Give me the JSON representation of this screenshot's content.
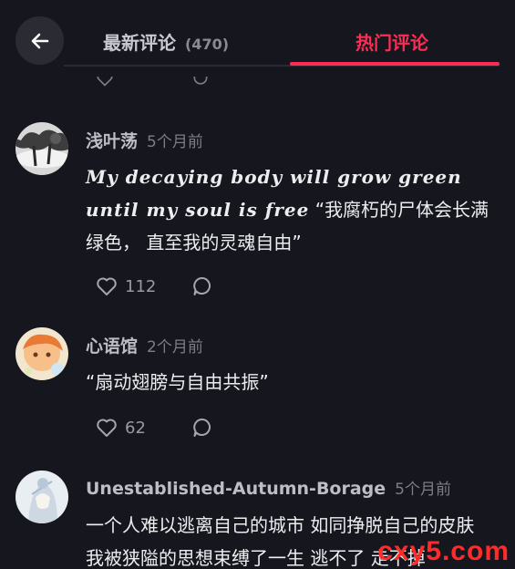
{
  "header": {
    "tab_latest_label": "最新评论",
    "tab_latest_count": "(470)",
    "tab_hot_label": "热门评论"
  },
  "comments": [
    {
      "username": "浅叶荡",
      "time": "5个月前",
      "text_fancy": "My decaying body will grow green until my soul is free",
      "text": " “我腐朽的尸体会长满绿色， 直至我的灵魂自由”",
      "likes": "112"
    },
    {
      "username": "心语馆",
      "time": "2个月前",
      "text": "“扇动翅膀与自由共振”",
      "likes": "62"
    },
    {
      "username": "Unestablished-Autumn-Borage",
      "time": "5个月前",
      "text": "一个人难以逃离自己的城市 如同挣脱自己的皮肤 我被狭隘的思想束缚了一生 逃不了 走不掉"
    }
  ],
  "watermark": "cxy5.com",
  "colors": {
    "accent": "#fe2c55",
    "background": "#16161e"
  }
}
